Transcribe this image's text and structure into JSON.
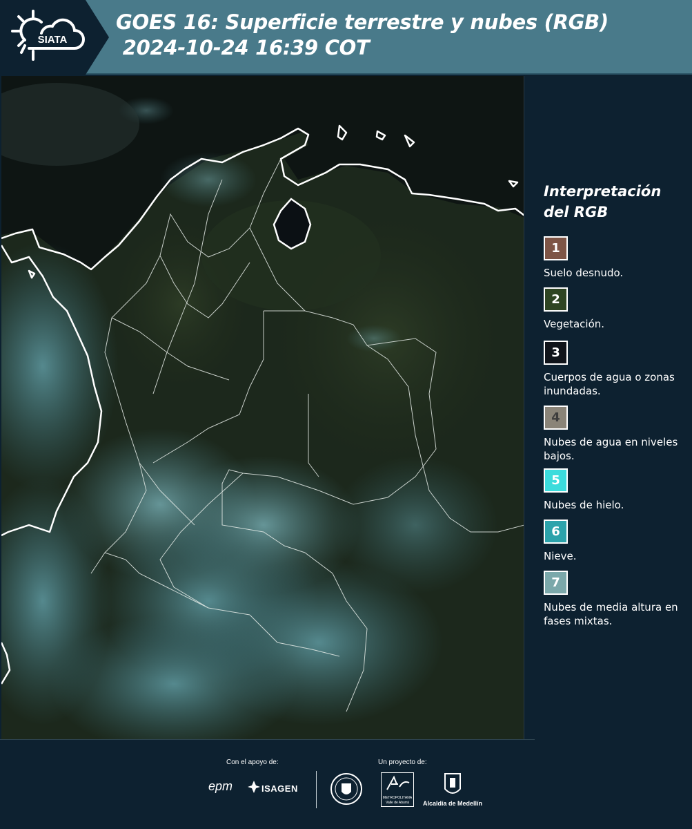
{
  "header": {
    "logo_text": "SIATA",
    "title_line1": "GOES 16: Superficie terrestre y nubes (RGB)",
    "title_line2": " 2024-10-24 16:39 COT",
    "bg_color": "#497a8a"
  },
  "legend": {
    "title_line1": "Interpretación",
    "title_line2": "del RGB",
    "items": [
      {
        "number": "1",
        "label": "Suelo desnudo.",
        "color": "#7e5546"
      },
      {
        "number": "2",
        "label": "Vegetación.",
        "color": "#2e4422"
      },
      {
        "number": "3",
        "label": "Cuerpos de agua o zonas inundadas.",
        "color": "#10141a"
      },
      {
        "number": "4",
        "label": "Nubes de agua en niveles bajos.",
        "color": "#8a8478"
      },
      {
        "number": "5",
        "label": "Nubes de hielo.",
        "color": "#3bdcdc"
      },
      {
        "number": "6",
        "label": "Nieve.",
        "color": "#2ca3ab"
      },
      {
        "number": "7",
        "label": "Nubes de media altura en fases mixtas.",
        "color": "#7ba8aa"
      }
    ]
  },
  "footer": {
    "support_label": "Con el apoyo de:",
    "project_label": "Un proyecto de:",
    "epm": "epm",
    "isagen": "ISAGEN",
    "metropolitana_line1": "METROPOLITANA",
    "metropolitana_line2": "Valle de Aburrá",
    "alcaldia": "Alcaldía de Medellín"
  }
}
